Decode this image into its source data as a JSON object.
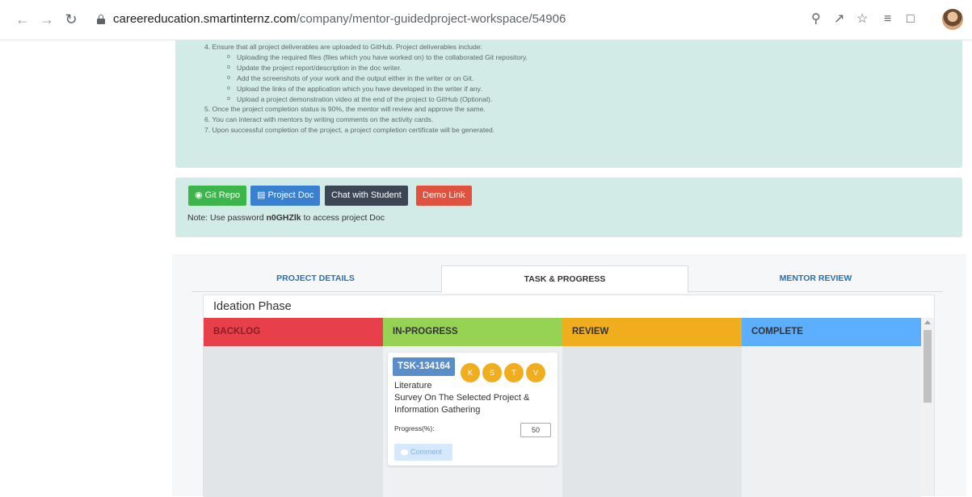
{
  "browser": {
    "url_domain": "careereducation.smartinternz.com",
    "url_path": "/company/mentor-guidedproject-workspace/54906"
  },
  "instructions": {
    "step4": "4. Ensure that all project deliverables are uploaded to GitHub. Project deliverables include:",
    "sub1": "Uploading the required files (files which you have worked on) to the collaborated Git repository.",
    "sub2": "Update the project report/description in the doc writer.",
    "sub3": "Add the screenshots of your work and the output either in the writer or on Git.",
    "sub4": "Upload the links of the application which you have developed in the writer if any.",
    "sub5": "Upload a project demonstration video at the end of the project to GitHub (Optional).",
    "step5": "5. Once the project completion status is 90%, the mentor will review and approve the same.",
    "step6": "6. You can interact with mentors by writing comments on the activity cards.",
    "step7": "7. Upon successful completion of the project, a project completion certificate will be generated."
  },
  "actions": {
    "git_repo": "Git Repo",
    "project_doc": "Project Doc",
    "chat": "Chat with Student",
    "demo": "Demo Link",
    "note_prefix": "Note: Use password ",
    "password": "n0GHZlk",
    "note_suffix": " to access project Doc"
  },
  "tabs": {
    "details": "PROJECT DETAILS",
    "task": "TASK & PROGRESS",
    "review": "MENTOR REVIEW"
  },
  "board": {
    "phase": "Ideation Phase",
    "columns": {
      "backlog": "BACKLOG",
      "in_progress": "IN-PROGRESS",
      "review": "REVIEW",
      "complete": "COMPLETE"
    },
    "task": {
      "id": "TSK-134164",
      "members": [
        "K",
        "S",
        "T",
        "V"
      ],
      "title_line1": "Literature",
      "title_line2": "Survey On The Selected Project &",
      "title_line3": "Information Gathering",
      "progress_label": "Progress(%):",
      "progress_value": "50",
      "comment": "Comment"
    }
  },
  "colors": {
    "panel_bg": "#d2ebe7",
    "backlog": "#e8404b",
    "in_progress": "#96d254",
    "review": "#f0ae1e",
    "complete": "#5caefe",
    "task_id_bg": "#5a8ec8",
    "member_bg": "#f0ae1e"
  }
}
